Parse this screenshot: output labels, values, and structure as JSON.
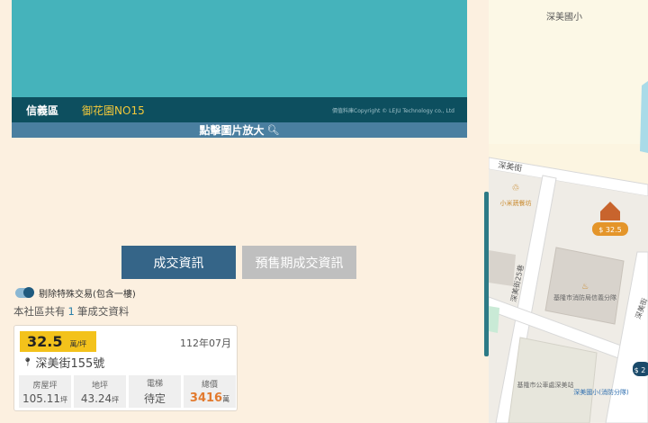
{
  "photo": {
    "district": "信義區",
    "community": "御花園NO15",
    "copyright": "價值料庫Copyright © LEJU Technology co., Ltd",
    "zoom_label": "點擊圖片放大",
    "zoom_icon": "magnifier-icon"
  },
  "tabs": {
    "deal": "成交資訊",
    "presale": "預售期成交資訊"
  },
  "filter": {
    "toggle_label": "剔除特殊交易(包含一樓)",
    "enabled": true
  },
  "summary": {
    "prefix": "本社區共有",
    "count": "1",
    "suffix": "筆成交資料"
  },
  "record": {
    "price": "32.5",
    "price_unit": "萬/坪",
    "date": "112年07月",
    "address": "深美街155號",
    "stats": [
      {
        "label": "房屋坪",
        "value": "105.11",
        "unit": "坪"
      },
      {
        "label": "地坪",
        "value": "43.24",
        "unit": "坪"
      },
      {
        "label": "電梯",
        "value": "待定",
        "unit": ""
      },
      {
        "label": "總價",
        "value": "3416",
        "unit": "萬"
      }
    ]
  },
  "map": {
    "labels": {
      "school": "深美國小",
      "street1": "深美街",
      "restaurant": "小米蔬餐坊",
      "price_badge1": "$ 32.5",
      "street2": "深美街25巷",
      "fire_station": "基隆市消防局信義分隊",
      "street3": "深美街",
      "parking": "基隆市公車處深美站",
      "school2": "深美國小(消防分隊)",
      "price_badge2": "$ 2"
    }
  }
}
